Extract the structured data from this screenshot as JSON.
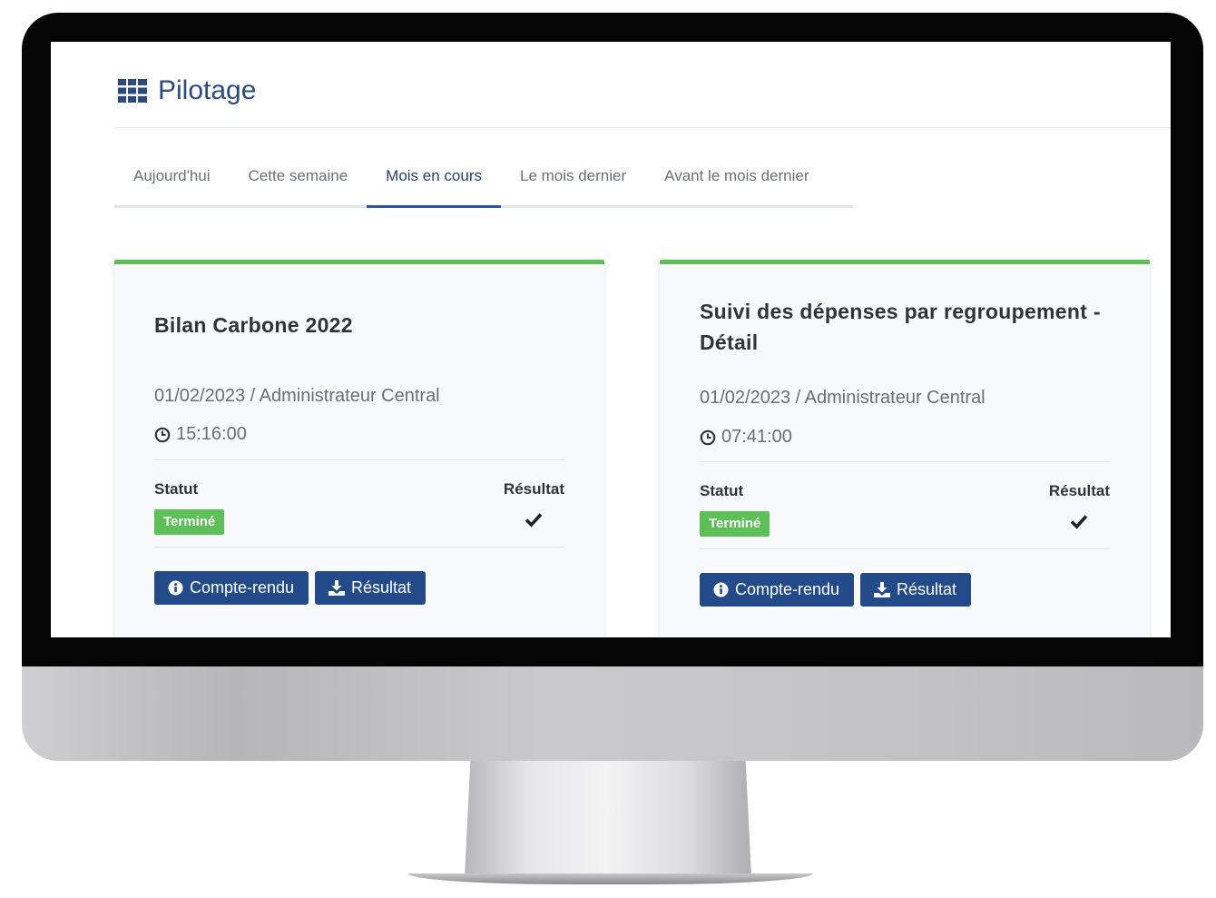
{
  "header": {
    "title": "Pilotage",
    "icon": "grid-icon"
  },
  "tabs": [
    {
      "label": "Aujourd'hui",
      "active": false
    },
    {
      "label": "Cette semaine",
      "active": false
    },
    {
      "label": "Mois en cours",
      "active": true
    },
    {
      "label": "Le mois dernier",
      "active": false
    },
    {
      "label": "Avant le mois dernier",
      "active": false
    }
  ],
  "cards": [
    {
      "title": "Bilan Carbone 2022",
      "meta": "01/02/2023 / Administrateur Central",
      "time": "15:16:00",
      "status_label": "Statut",
      "status": "Terminé",
      "result_label": "Résultat",
      "result_icon": "check-icon",
      "buttons": {
        "report": "Compte-rendu",
        "result": "Résultat"
      }
    },
    {
      "title": "Suivi des dépenses par regroupement - Détail",
      "meta": "01/02/2023 / Administrateur Central",
      "time": "07:41:00",
      "status_label": "Statut",
      "status": "Terminé",
      "result_label": "Résultat",
      "result_icon": "check-icon",
      "buttons": {
        "report": "Compte-rendu",
        "result": "Résultat"
      }
    }
  ],
  "colors": {
    "brand": "#2c4a7e",
    "button": "#234b8a",
    "success": "#5cbf58",
    "active_tab_underline": "#2a53a2"
  }
}
